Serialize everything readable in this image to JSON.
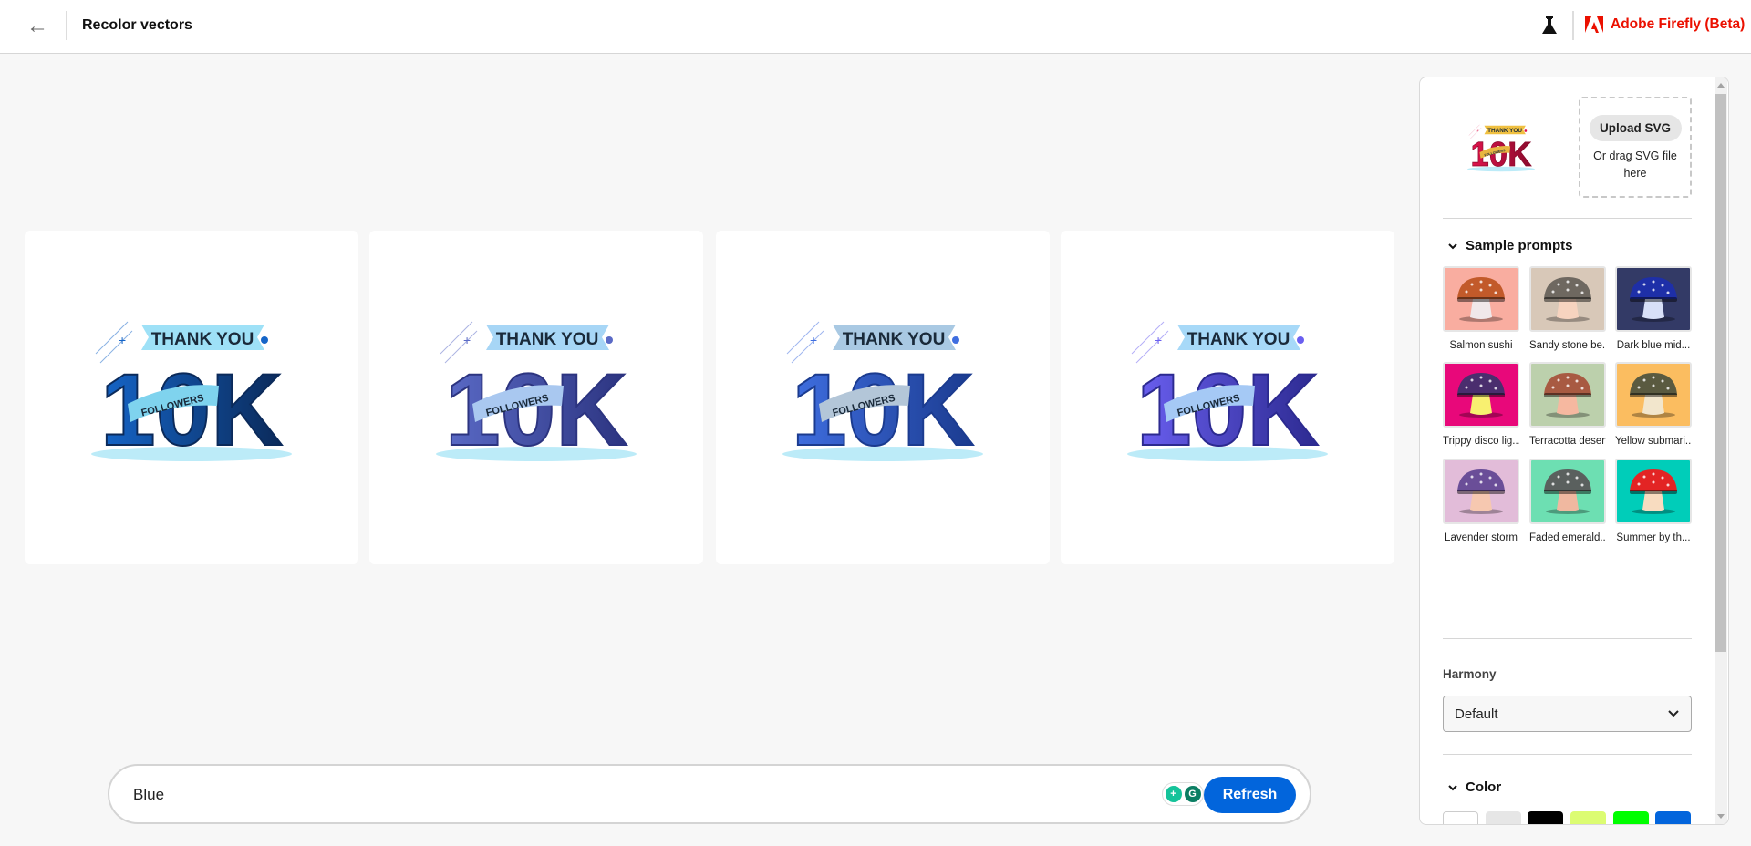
{
  "header": {
    "title": "Recolor vectors",
    "brand": "Adobe Firefly (Beta)",
    "brand_color": "#eb1000"
  },
  "artwork": {
    "line1": "THANK YOU",
    "line2": "10K",
    "ribbon": "FOLLOWERS"
  },
  "results": [
    {
      "main": "#1565c8",
      "dark": "#0b2a5a",
      "ribbon": "#7fd3ee",
      "banner": "#9ee1f7"
    },
    {
      "main": "#5a6ac6",
      "dark": "#2c3480",
      "ribbon": "#a9c8f0",
      "banner": "#a7d6f6"
    },
    {
      "main": "#3f6ee0",
      "dark": "#1b3b8f",
      "ribbon": "#b3c6d8",
      "banner": "#a9c9e3"
    },
    {
      "main": "#6a5ff0",
      "dark": "#2c2a90",
      "ribbon": "#a5c9f5",
      "banner": "#a7d9f8"
    }
  ],
  "panel": {
    "upload_label": "Upload SVG",
    "drag_text": "Or drag SVG file here",
    "sample_prompts_title": "Sample prompts",
    "samples": [
      {
        "label": "Salmon sushi",
        "bg": "#f9ada0",
        "cap": "#c25a2a",
        "stem": "#f0e8ea"
      },
      {
        "label": "Sandy stone be...",
        "bg": "#d8c8b8",
        "cap": "#6e6860",
        "stem": "#f6d3bf"
      },
      {
        "label": "Dark blue mid...",
        "bg": "#333a66",
        "cap": "#1e2fa8",
        "stem": "#d8e0f8"
      },
      {
        "label": "Trippy disco lig...",
        "bg": "#e8087a",
        "cap": "#4a2e6e",
        "stem": "#f8f070"
      },
      {
        "label": "Terracotta desert",
        "bg": "#bcd0ac",
        "cap": "#a85a42",
        "stem": "#f6b8a0"
      },
      {
        "label": "Yellow submari...",
        "bg": "#fbbd60",
        "cap": "#5a5a40",
        "stem": "#f2e6cc"
      },
      {
        "label": "Lavender storm",
        "bg": "#e2bcd9",
        "cap": "#6a4e98",
        "stem": "#f6c8b0"
      },
      {
        "label": "Faded emerald...",
        "bg": "#6ddfb2",
        "cap": "#5a605e",
        "stem": "#f0b8a0"
      },
      {
        "label": "Summer by th...",
        "bg": "#00cdb9",
        "cap": "#e32424",
        "stem": "#f8dcc0"
      }
    ],
    "harmony_label": "Harmony",
    "harmony_value": "Default",
    "color_title": "Color",
    "swatches": [
      "#ffffff",
      "#e6e6e6",
      "#000000",
      "#dcfc72",
      "#00ff00",
      "#0265dc"
    ]
  },
  "prompt": {
    "value": "Blue",
    "refresh_label": "Refresh",
    "accent": "#0265dc"
  }
}
